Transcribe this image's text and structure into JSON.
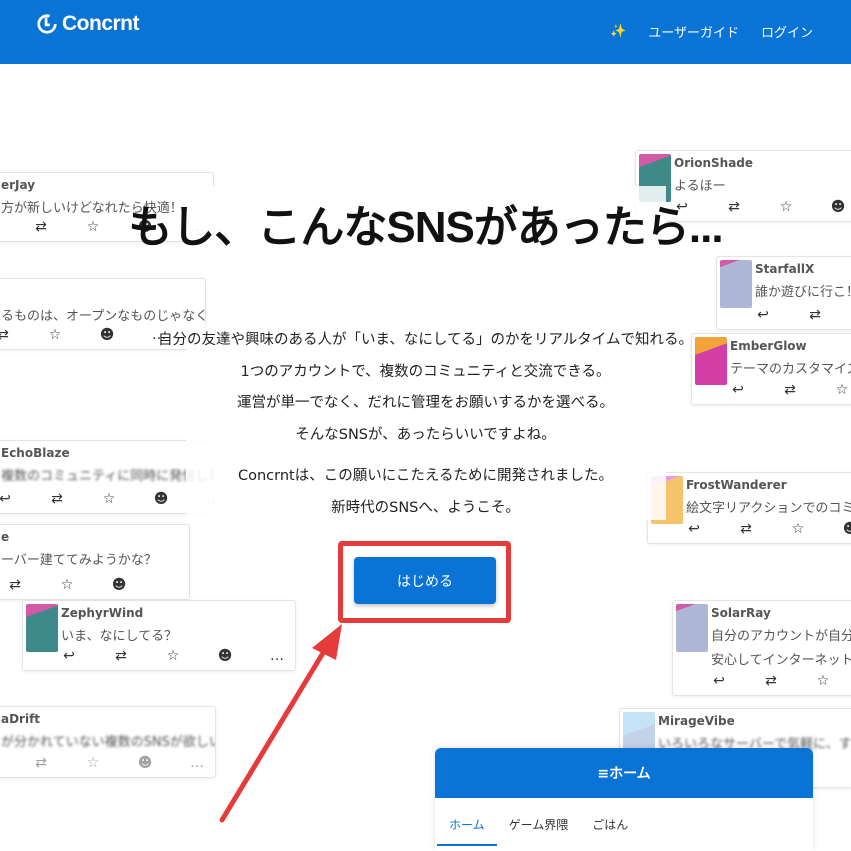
{
  "header": {
    "brand": "Concrnt",
    "sparkle": "✨",
    "nav": [
      "ユーザーガイド",
      "ログイン"
    ]
  },
  "hero": {
    "title": "もし、こんなSNSがあったら...",
    "lines": [
      "自分の友達や興味のある人が「いま、なにしてる」のかをリアルタイムで知れる。",
      "1つのアカウントで、複数のコミュニティと交流できる。",
      "運営が単一でなく、だれに管理をお願いするかを選べる。",
      "そんなSNSが、あったらいいですよね。"
    ],
    "lines2": [
      "Concrntは、この願いにこたえるために開発されました。",
      "新時代のSNSへ、ようこそ。"
    ],
    "cta": "はじめる"
  },
  "actions": {
    "reply": "↩",
    "repost": "⇄",
    "fav": "☆",
    "react": "☻",
    "more": "…"
  },
  "posts": [
    {
      "name": "erJay",
      "text": "方が新しいけどなれたら快適！"
    },
    {
      "name": "",
      "text": "るものは、オープンなものじゃなくっちゃね"
    },
    {
      "name": "EchoBlaze",
      "text": "複数のコミュニティに同時に発信したい！"
    },
    {
      "name": "e",
      "text": "ーバー建ててみようかな？"
    },
    {
      "name": "ZephyrWind",
      "text": "いま、なにしてる？"
    },
    {
      "name": "aDrift",
      "text": "が分かれていない複数のSNSが欲しい"
    },
    {
      "name": "OrionShade",
      "text": "よるほー"
    },
    {
      "name": "StarfallX",
      "text": "誰か遊びに行こ！"
    },
    {
      "name": "EmberGlow",
      "text": "テーマのカスタマイズが楽しい"
    },
    {
      "name": "FrostWanderer",
      "text": "絵文字リアクションでのコミュニケーション"
    },
    {
      "name": "SolarRay",
      "text": "自分のアカウントが自分の手の中に",
      "text2": "安心してインターネットアイデンティティ"
    },
    {
      "name": "MirageVibe",
      "text": "いろいろなサーバーで気軽に、すぐに"
    }
  ],
  "home_panel": {
    "title": "≡ホーム",
    "tabs": [
      "ホーム",
      "ゲーム界隈",
      "ごはん"
    ]
  },
  "colors": {
    "brand": "#0a73d6",
    "highlight": "#e53b3b"
  }
}
